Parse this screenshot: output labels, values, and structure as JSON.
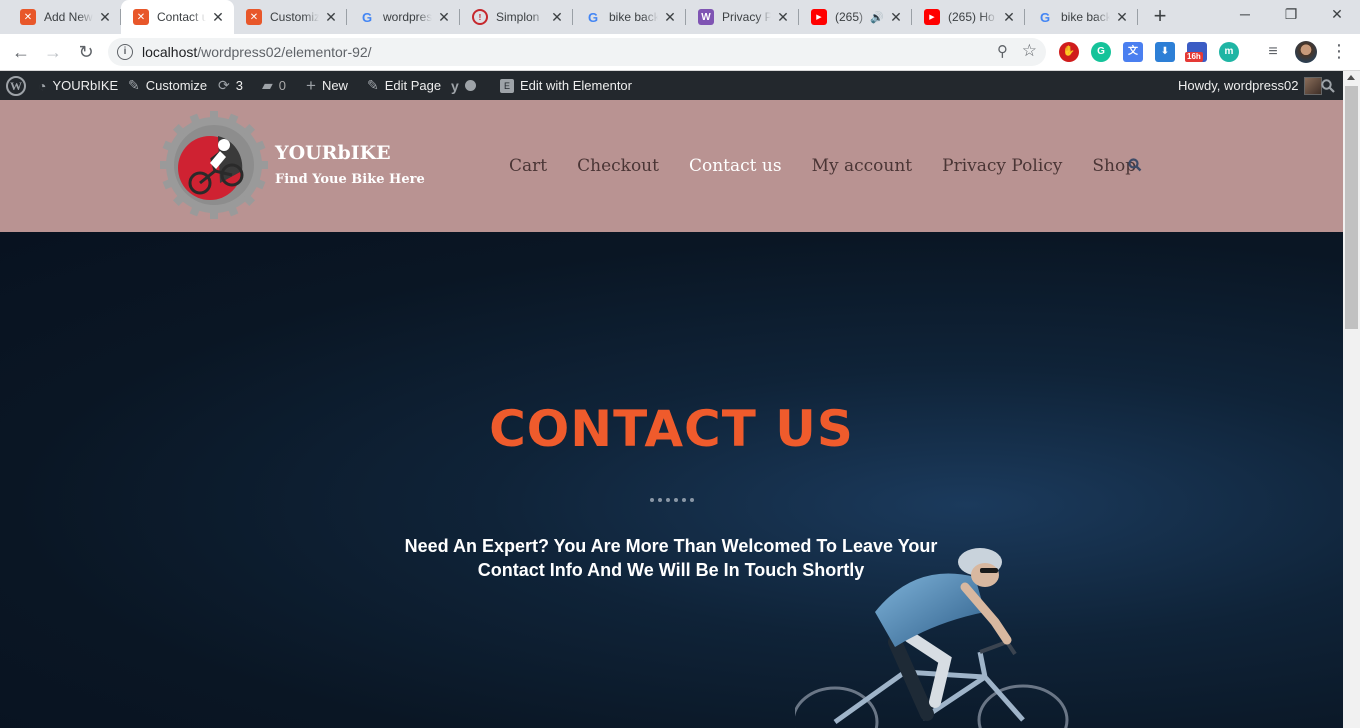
{
  "browser": {
    "tabs": [
      {
        "title": "Add New",
        "icon": "xampp-icon",
        "active": false
      },
      {
        "title": "Contact us",
        "icon": "xampp-icon",
        "active": true
      },
      {
        "title": "Customize",
        "icon": "xampp-icon",
        "active": false
      },
      {
        "title": "wordpress",
        "icon": "google-icon",
        "active": false
      },
      {
        "title": "Simplon",
        "icon": "simplon-icon",
        "active": false
      },
      {
        "title": "bike back",
        "icon": "google-icon",
        "active": false
      },
      {
        "title": "Privacy P",
        "icon": "woocommerce-icon",
        "active": false
      },
      {
        "title": "(265)",
        "icon": "youtube-icon",
        "active": false,
        "audio": true
      },
      {
        "title": "(265) Ho",
        "icon": "youtube-icon",
        "active": false
      },
      {
        "title": "bike back",
        "icon": "google-icon",
        "active": false
      }
    ],
    "url_host": "localhost",
    "url_path": "/wordpress02/elementor-92/",
    "extension_badge": "16h"
  },
  "admin_bar": {
    "site_name": "YOURbIKE",
    "customize": "Customize",
    "updates_count": "3",
    "comments_count": "0",
    "new_label": "New",
    "edit_page": "Edit Page",
    "edit_elementor": "Edit with Elementor",
    "howdy": "Howdy, wordpress02"
  },
  "site": {
    "title": "YOURbIKE",
    "tagline": "Find Youe Bike Here",
    "nav": [
      {
        "label": "Cart",
        "current": false
      },
      {
        "label": "Checkout",
        "current": false
      },
      {
        "label": "Contact us",
        "current": true
      },
      {
        "label": "My account",
        "current": false
      },
      {
        "label": "Privacy Policy",
        "current": false
      },
      {
        "label": "Shop",
        "current": false
      }
    ],
    "header_color": "#b99392"
  },
  "hero": {
    "title": "CONTACT US",
    "subtitle_line1": "Need An Expert? You Are More Than Welcomed To Leave Your",
    "subtitle_line2": "Contact Info And We Will Be In Touch Shortly",
    "title_color": "#ef5b2c"
  }
}
